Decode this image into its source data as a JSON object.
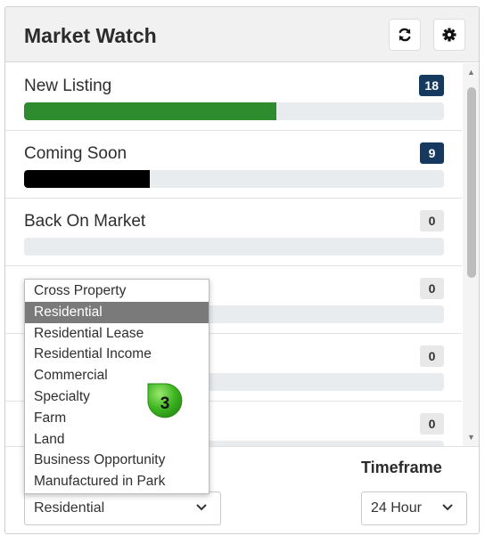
{
  "panel": {
    "title": "Market Watch",
    "refresh_icon": "refresh-icon",
    "settings_icon": "gear-icon"
  },
  "rows": [
    {
      "label": "New Listing",
      "count": "18",
      "badge_style": "dark",
      "progress": 0.6,
      "bar_color": "#2e8b2e"
    },
    {
      "label": "Coming Soon",
      "count": "9",
      "badge_style": "dark",
      "progress": 0.3,
      "bar_color": "#000000"
    },
    {
      "label": "Back On Market",
      "count": "0",
      "badge_style": "light",
      "progress": 0,
      "bar_color": "#e9ecef"
    },
    {
      "label": "",
      "count": "0",
      "badge_style": "light",
      "progress": 0,
      "bar_color": "#e9ecef"
    },
    {
      "label": "",
      "count": "0",
      "badge_style": "light",
      "progress": 0,
      "bar_color": "#e9ecef"
    },
    {
      "label": "",
      "count": "0",
      "badge_style": "light",
      "progress": 0,
      "bar_color": "#e9ecef"
    }
  ],
  "dropdown": {
    "options": [
      "Cross Property",
      "Residential",
      "Residential Lease",
      "Residential Income",
      "Commercial",
      "Specialty",
      "Farm",
      "Land",
      "Business Opportunity",
      "Manufactured in Park"
    ],
    "selected_index": 1
  },
  "footer": {
    "property_type_value": "Residential",
    "timeframe_label": "Timeframe",
    "timeframe_value": "24 Hour"
  },
  "step_marker": {
    "number": "3",
    "color": "#3cb521"
  },
  "colors": {
    "badge_dark": "#163a5f",
    "progress_green": "#2e8b2e",
    "progress_black": "#000000"
  }
}
